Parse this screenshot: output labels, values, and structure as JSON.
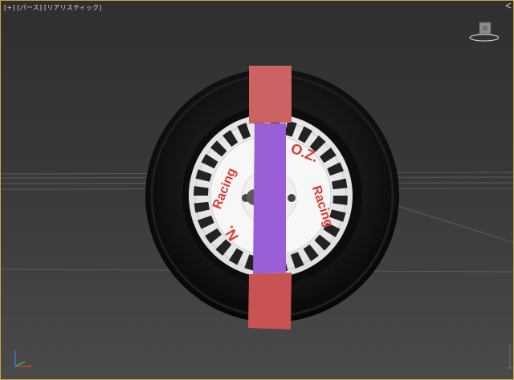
{
  "viewport": {
    "label_plus": "[+]",
    "label_view": "[パース]",
    "label_shading": "[リアリスティック]"
  },
  "wheel": {
    "brand_left": "Racing",
    "brand_right": "Racing",
    "brand_top": "O.Z.",
    "brand_bottom": "N."
  },
  "colors": {
    "tire": "#111111",
    "rim": "#f2f2f2",
    "logo_red": "#d93a33",
    "strap_red": "#cc5a5a",
    "strap_purple": "#9a5ed6",
    "frame": "#c9a341"
  },
  "icons": {
    "viewcube": "viewcube-icon",
    "axis_tripod": "axis-tripod-icon"
  }
}
